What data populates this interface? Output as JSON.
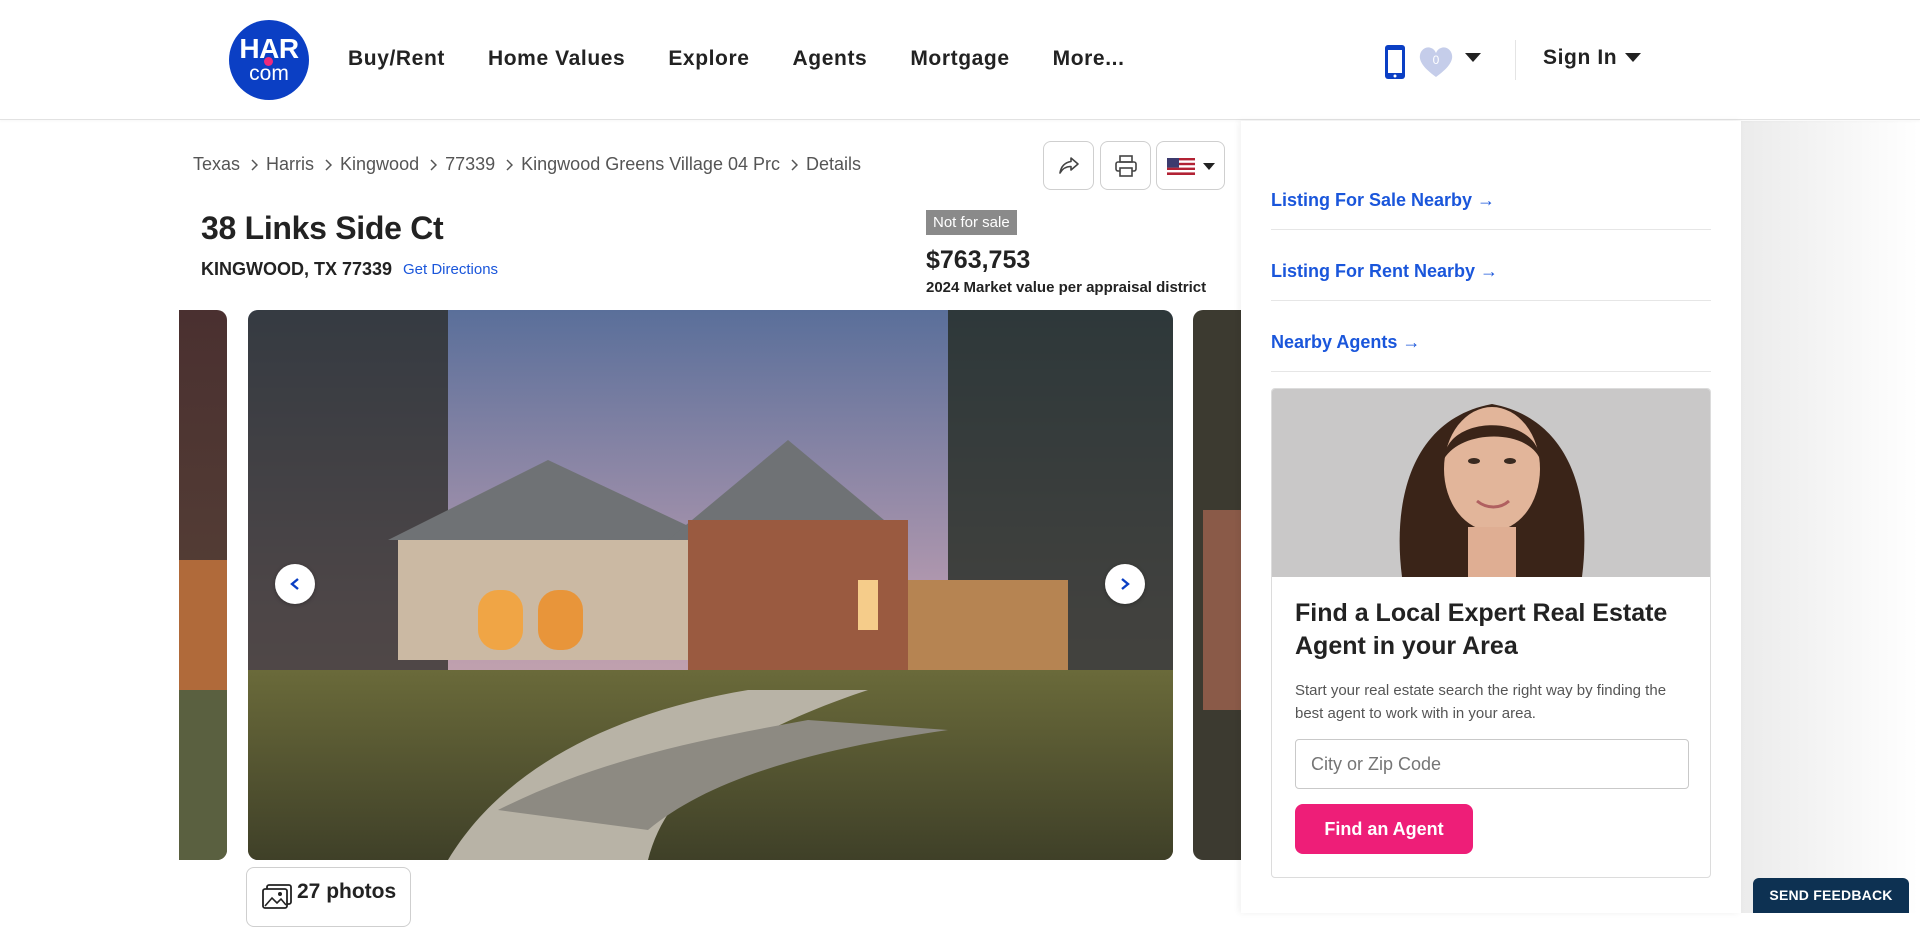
{
  "header": {
    "logo_top": "HAR",
    "logo_bottom": "com",
    "nav": [
      "Buy/Rent",
      "Home Values",
      "Explore",
      "Agents",
      "Mortgage",
      "More..."
    ],
    "favorites_count": "0",
    "sign_in": "Sign In",
    "accent_color": "#0b3fc4"
  },
  "breadcrumb": [
    "Texas",
    "Harris",
    "Kingwood",
    "77339",
    "Kingwood Greens Village 04 Prc",
    "Details"
  ],
  "toolbar": {
    "share_icon": "share-icon",
    "print_icon": "print-icon",
    "language_icon": "us-flag-icon"
  },
  "listing": {
    "title": "38 Links Side Ct",
    "address": "KINGWOOD, TX 77339",
    "directions": "Get Directions",
    "status": "Not for sale",
    "price": "$763,753",
    "price_note": "2024 Market value per appraisal district",
    "photos_label": "27 photos"
  },
  "panel": {
    "links": [
      "Listing For Sale Nearby →",
      "Listing For Rent Nearby →",
      "Nearby Agents →"
    ],
    "card_title": "Find a Local Expert Real Estate Agent in your Area",
    "card_desc": "Start your real estate search the right way by finding the best agent to work with in your area.",
    "input_placeholder": "City or Zip Code",
    "button": "Find an Agent",
    "button_color": "#ee1e78"
  },
  "feedback": "SEND FEEDBACK"
}
